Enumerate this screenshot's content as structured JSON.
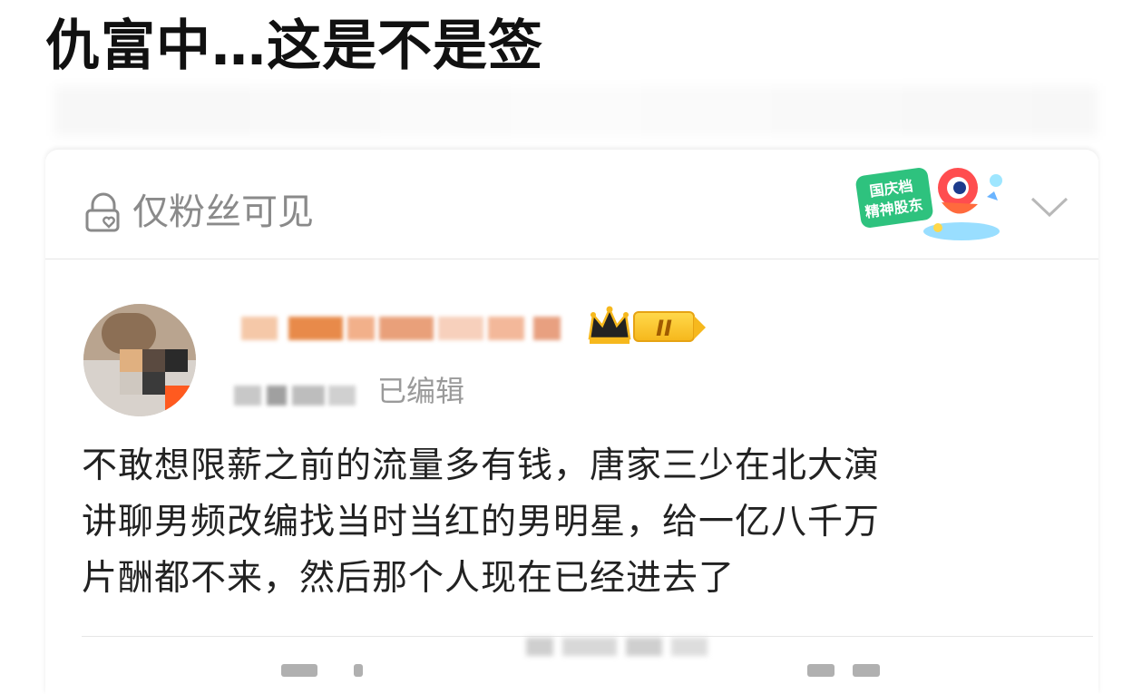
{
  "headline": "仇富中…这是不是签",
  "visibility": {
    "label": "仅粉丝可见",
    "badge_text_line1": "国庆档",
    "badge_text_line2": "精神股东"
  },
  "post": {
    "level_badge": "II",
    "edited_label": "已编辑",
    "body_lines": [
      "不敢想限薪之前的流量多有钱，唐家三少在北大演",
      "讲聊男频改编找当时当红的男明星，给一亿八千万",
      "片酬都不来，然后那个人现在已经进去了"
    ]
  },
  "colors": {
    "accent_gold": "#f6b81d",
    "muted_text": "#8a8a8a",
    "badge_green": "#2ec27e"
  }
}
